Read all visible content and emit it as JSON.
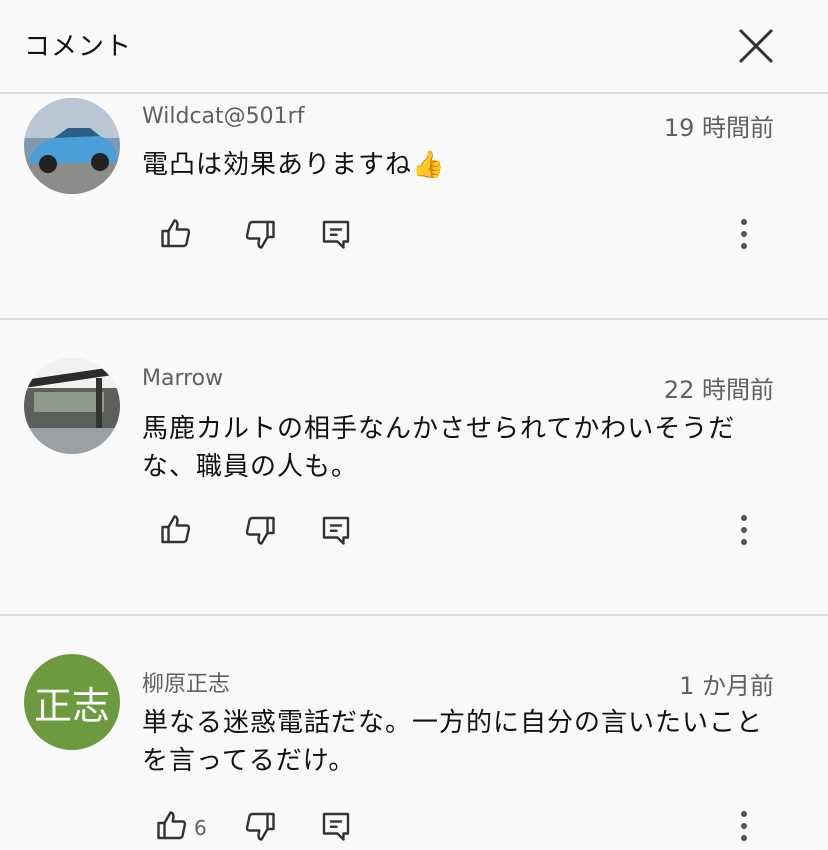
{
  "header": {
    "title": "コメント"
  },
  "colors": {
    "accent_avatar_3": "#6d9a3e",
    "text_secondary": "#606060",
    "divider": "#dcdcdc"
  },
  "comments": [
    {
      "author": "Wildcat@501rf",
      "time": "19 時間前",
      "text": "電凸は効果ありますね👍",
      "like_count": "",
      "avatar_icon": "car-photo"
    },
    {
      "author": "Marrow",
      "time": "22 時間前",
      "text": "馬鹿カルトの相手なんかさせられてかわいそうだな、職員の人も。",
      "like_count": "",
      "avatar_icon": "building-photo"
    },
    {
      "author": "柳原正志",
      "time": "1 か月前",
      "text": "単なる迷惑電話だな。一方的に自分の言いたいことを言ってるだけ。",
      "like_count": "6",
      "avatar_text": "正志"
    }
  ]
}
